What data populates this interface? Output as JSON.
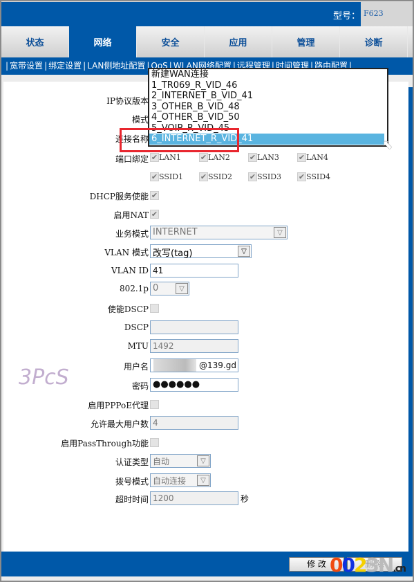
{
  "header": {
    "model_label": "型号：",
    "model_value": "F623"
  },
  "tabs": [
    "状态",
    "网络",
    "安全",
    "应用",
    "管理",
    "诊断"
  ],
  "active_tab": "网络",
  "submenu": [
    "宽带设置",
    "绑定设置",
    "LAN侧地址配置",
    "QoS",
    "WLAN网络配置",
    "远程管理",
    "时间管理",
    "路由配置"
  ],
  "form": {
    "ip_version_label": "IP协议版本",
    "mode_label": "模式",
    "conn_name_label": "连接名称",
    "port_binding_label": "端口绑定",
    "ports": [
      "LAN1",
      "LAN2",
      "LAN3",
      "LAN4"
    ],
    "ssids": [
      "SSID1",
      "SSID2",
      "SSID3",
      "SSID4"
    ],
    "dhcp_label": "DHCP服务使能",
    "nat_label": "启用NAT",
    "service_mode_label": "业务模式",
    "service_mode": "INTERNET",
    "vlan_mode_label": "VLAN 模式",
    "vlan_mode": "改写(tag)",
    "vlan_id_label": "VLAN ID",
    "vlan_id": "41",
    "p8021_label": "802.1p",
    "p8021": "0",
    "dscp_enable_label": "使能DSCP",
    "dscp_label": "DSCP",
    "dscp": "",
    "mtu_label": "MTU",
    "mtu": "1492",
    "username_label": "用户名",
    "username": "@139.gd",
    "password_label": "密码",
    "password": "●●●●●●",
    "pppoe_proxy_label": "启用PPPoE代理",
    "max_users_label": "允许最大用户数",
    "max_users": "4",
    "passthrough_label": "启用PassThrough功能",
    "auth_type_label": "认证类型",
    "auth_type": "自动",
    "dial_mode_label": "拨号模式",
    "dial_mode": "自动连接",
    "timeout_label": "超时时间",
    "timeout": "1200",
    "timeout_unit": "秒"
  },
  "dropdown": {
    "options": [
      "新建WAN连接",
      "1_TR069_R_VID_46",
      "2_INTERNET_B_VID_41",
      "3_OTHER_B_VID_48",
      "4_OTHER_B_VID_50",
      "5_VOIP_R_VID_45",
      "6_INTERNET_R_VID_41"
    ],
    "selected": "6_INTERNET_R_VID_41"
  },
  "footer": {
    "modify": "修 改",
    "delete": "删 除"
  },
  "watermark": {
    "text": "0023N",
    "suffix": ".cn",
    "logo": "3PCS"
  },
  "colors": {
    "primary": "#0058a8",
    "highlight": "#5ab4e0",
    "annotation": "#e8262e"
  }
}
